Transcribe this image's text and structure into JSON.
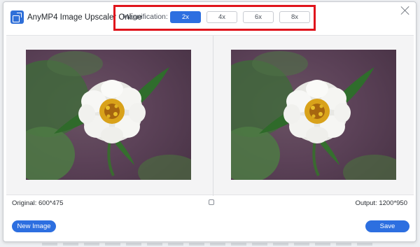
{
  "app": {
    "title": "AnyMP4 Image Upscaler Online",
    "logo_icon": "upscale-logo-icon"
  },
  "magnification": {
    "label": "Magnification:",
    "options": [
      "2x",
      "4x",
      "6x",
      "8x"
    ],
    "selected": "2x",
    "highlight_color": "#e0141c"
  },
  "preview": {
    "original_label": "Original: 600*475",
    "output_label": "Output: 1200*950",
    "compare_icon": "compare-toggle-icon"
  },
  "actions": {
    "new_image": "New Image",
    "save": "Save"
  },
  "colors": {
    "accent": "#2d6fe0"
  }
}
